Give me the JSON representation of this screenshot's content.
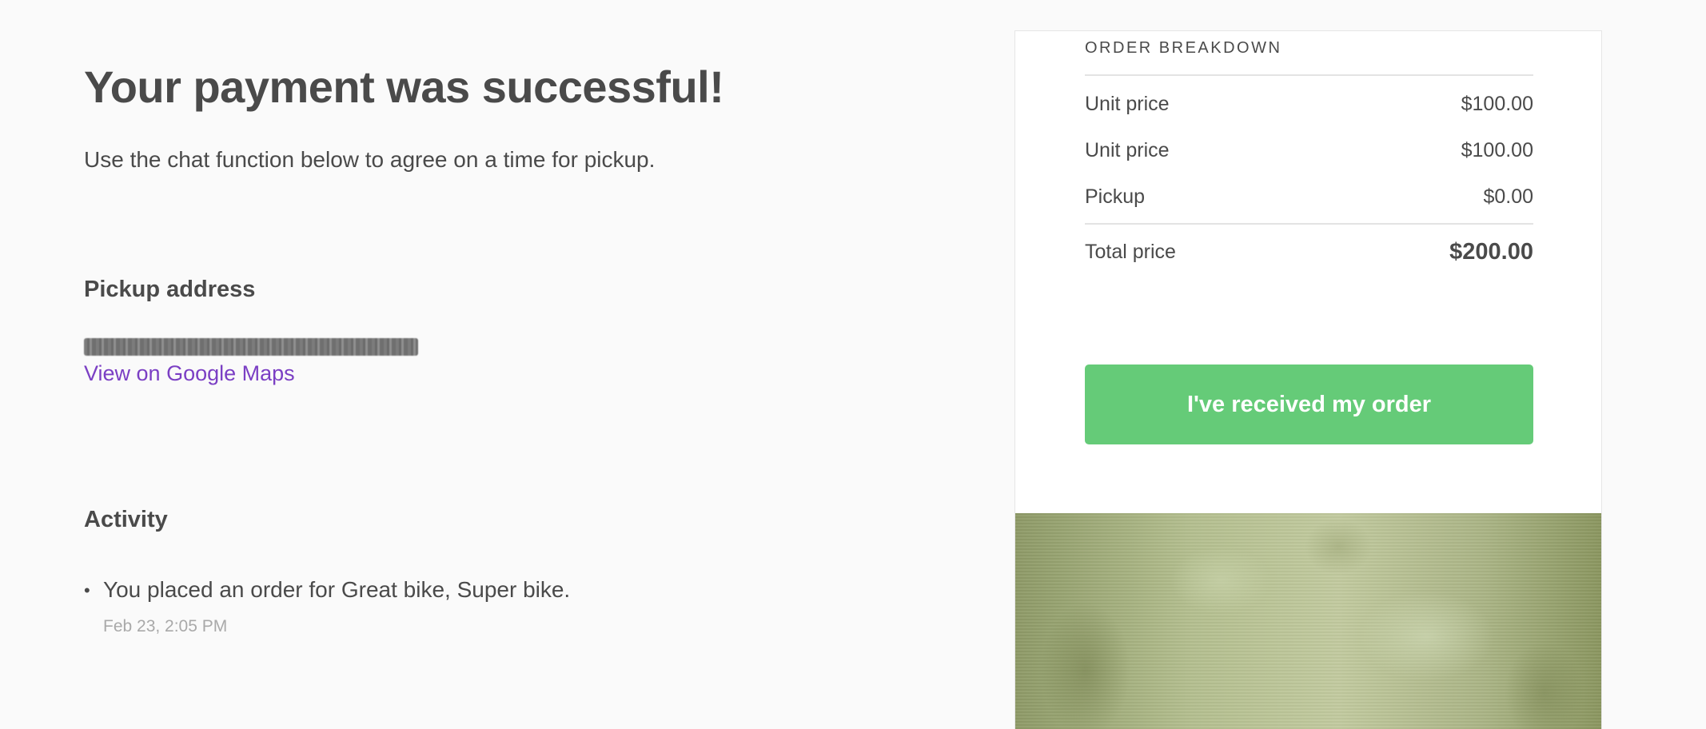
{
  "header": {
    "title": "Your payment was successful!",
    "subtitle": "Use the chat function below to agree on a time for pickup."
  },
  "pickup": {
    "heading": "Pickup address",
    "map_link": "View on Google Maps"
  },
  "activity": {
    "heading": "Activity",
    "items": [
      {
        "text": "You placed an order for Great bike, Super bike.",
        "time": "Feb 23, 2:05 PM"
      }
    ]
  },
  "order": {
    "breakdown_title": "ORDER BREAKDOWN",
    "line_items": [
      {
        "label": "Unit price",
        "value": "$100.00"
      },
      {
        "label": "Unit price",
        "value": "$100.00"
      },
      {
        "label": "Pickup",
        "value": "$0.00"
      }
    ],
    "total_label": "Total price",
    "total_value": "$200.00",
    "received_button": "I've received my order"
  },
  "colors": {
    "link": "#7b3fc4",
    "button": "#65cb78",
    "text": "#4a4a4a",
    "muted": "#a9a9a9"
  }
}
